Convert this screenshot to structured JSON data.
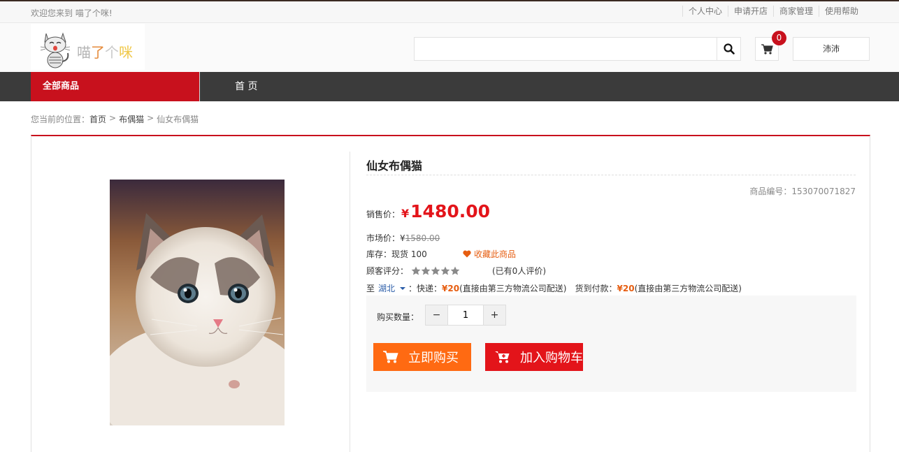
{
  "topbar": {
    "welcome": "欢迎您来到 喵了个咪!",
    "links": [
      "个人中心",
      "申请开店",
      "商家管理",
      "使用帮助"
    ]
  },
  "header": {
    "logo_text": [
      "喵",
      "了",
      "个",
      "咪"
    ],
    "search_value": "",
    "cart_count": "0",
    "user_label": "沛沛"
  },
  "nav": {
    "all_products": "全部商品",
    "home": "首 页"
  },
  "breadcrumb": {
    "prefix": "您当前的位置：",
    "items": [
      "首页",
      "布偶猫",
      "仙女布偶猫"
    ],
    "separator": ">"
  },
  "product": {
    "title": "仙女布偶猫",
    "code_label": "商品编号：",
    "code": "153070071827",
    "sale_price_label": "销售价：",
    "currency": "¥",
    "sale_price": "1480.00",
    "market_price_label": "市场价：",
    "market_price": "1580.00",
    "stock_label": "库存：",
    "stock_value": "现货 100",
    "favorite_label": "收藏此商品",
    "rating_label": "顾客评分：",
    "rating": 0,
    "rating_max": 5,
    "reviews": "(已有0人评价)",
    "ship_to_label": "至",
    "ship_region": "湖北",
    "express_label": "：快递：",
    "express_price": "¥20",
    "express_note": "(直接由第三方物流公司配送)",
    "cod_label": "货到付款：",
    "cod_price": "¥20",
    "cod_note": "(直接由第三方物流公司配送)",
    "quantity_label": "购买数量：",
    "quantity": "1",
    "minus": "−",
    "plus": "+",
    "buy_now": "立即购买",
    "add_to_cart": "加入购物车"
  },
  "colors": {
    "brand_red": "#c8111d",
    "price_red": "#e3141a",
    "orange": "#ff6a12",
    "nav_dark": "#3b3b3b"
  },
  "icons": {
    "search": "search-icon",
    "cart": "cart-icon",
    "heart": "heart-icon",
    "star": "star-icon",
    "caret": "caret-down-icon"
  }
}
